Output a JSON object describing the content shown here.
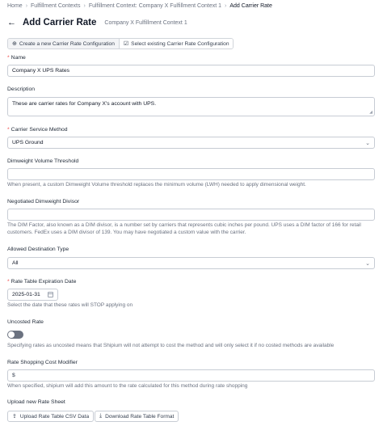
{
  "breadcrumb": {
    "home": "Home",
    "fulfillment_contexts": "Fulfillment Contexts",
    "context": "Fulfillment Context: Company X Fulfillment Context 1",
    "current": "Add Carrier Rate"
  },
  "header": {
    "title": "Add Carrier Rate",
    "subtitle": "Company X Fulfillment Context 1"
  },
  "mode_toggle": {
    "create_label": "Create a new Carrier Rate Configuration",
    "select_label": "Select existing Carrier Rate Configuration",
    "selected": "create"
  },
  "form": {
    "name": {
      "label": "Name",
      "value": "Company X UPS Rates"
    },
    "description": {
      "label": "Description",
      "value": "These are carrier rates for Company X's account with UPS."
    },
    "carrier_service_method": {
      "label": "Carrier Service Method",
      "value": "UPS Ground"
    },
    "dimweight_threshold": {
      "label": "Dimweight Volume Threshold",
      "value": "",
      "help": "When present, a custom Dimweight Volume threshold replaces the minimum volume (LWH) needed to apply dimensional weight."
    },
    "dimweight_divisor": {
      "label": "Negotiated Dimweight Divisor",
      "value": "",
      "help": "The DIM Factor, also known as a DIM divisor, is a number set by carriers that represents cubic inches per pound. UPS uses a DIM factor of 166 for retail customers. FedEx uses a DIM divisor of 139. You may have negotiated a custom value with the carrier."
    },
    "allowed_destination_type": {
      "label": "Allowed Destination Type",
      "value": "All"
    },
    "expiration_date": {
      "label": "Rate Table Expiration Date",
      "value": "2025-01-31",
      "help": "Select the date that these rates will STOP applying on"
    },
    "uncosted_rate": {
      "label": "Uncosted Rate",
      "enabled": false,
      "help": "Specifying rates as uncosted means that Shipium will not attempt to cost the method and will only select it if no costed methods are available"
    },
    "cost_modifier": {
      "label": "Rate Shopping Cost Modifier",
      "prefix": "$",
      "value": "",
      "help": "When specified, shipium will add this amount to the rate calculated for this method during rate shopping"
    },
    "rate_sheet": {
      "label": "Upload new Rate Sheet",
      "upload_label": "Upload Rate Table CSV Data",
      "download_label": "Download Rate Table Format"
    }
  },
  "colors": {
    "required": "#ef4444",
    "switch_off": "#6b7280",
    "border": "#c7ccd4"
  }
}
